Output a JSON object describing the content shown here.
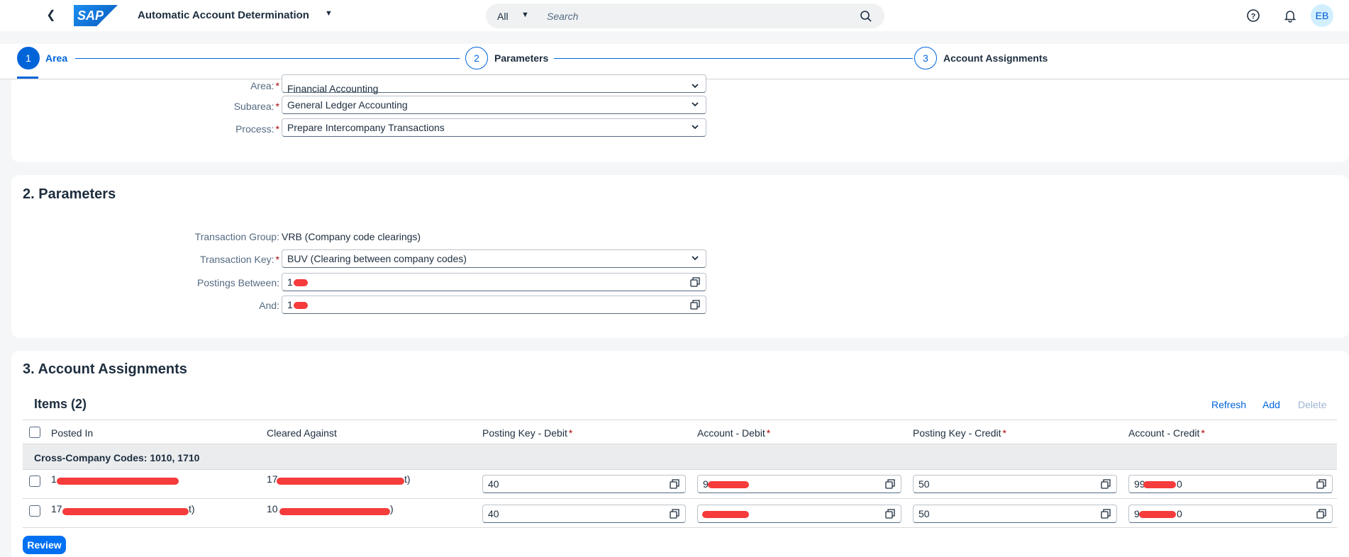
{
  "shell": {
    "logo": "SAP",
    "app_title": "Automatic Account Determination",
    "search_scope": "All",
    "search_placeholder": "Search",
    "avatar_initials": "EB"
  },
  "wizard": {
    "steps": [
      {
        "number": "1",
        "label": "Area",
        "active": true
      },
      {
        "number": "2",
        "label": "Parameters",
        "active": false
      },
      {
        "number": "3",
        "label": "Account Assignments",
        "active": false
      }
    ]
  },
  "area": {
    "fields": [
      {
        "label": "Area:",
        "value": "Financial Accounting"
      },
      {
        "label": "Subarea:",
        "value": "General Ledger Accounting"
      },
      {
        "label": "Process:",
        "value": "Prepare Intercompany Transactions"
      }
    ]
  },
  "parameters": {
    "title": "2. Parameters",
    "transaction_group_label": "Transaction Group:",
    "transaction_group_value": "VRB (Company code clearings)",
    "transaction_key_label": "Transaction Key:",
    "transaction_key_value": "BUV (Clearing between company codes)",
    "postings_between_label": "Postings Between:",
    "postings_between_value": "1",
    "and_label": "And:",
    "and_value": "1"
  },
  "assignments": {
    "title": "3. Account Assignments",
    "items_title": "Items (2)",
    "toolbar": {
      "refresh": "Refresh",
      "add": "Add",
      "delete": "Delete"
    },
    "columns": [
      "Posted In",
      "Cleared Against",
      "Posting Key - Debit",
      "Account - Debit",
      "Posting Key - Credit",
      "Account - Credit"
    ],
    "required_marker": "*",
    "group_label": "Cross-Company Codes: 1010, 1710",
    "rows": [
      {
        "posted_in": "1",
        "cleared_against": "17",
        "cleared_suffix": "t)",
        "pk_debit": "40",
        "acct_debit": "9",
        "pk_credit": "50",
        "acct_credit": "99",
        "acct_credit_suffix": "0"
      },
      {
        "posted_in": "17",
        "posted_suffix": "t)",
        "cleared_against": "10",
        "cleared_suffix": ")",
        "pk_debit": "40",
        "acct_debit": "",
        "pk_credit": "50",
        "acct_credit": "9",
        "acct_credit_suffix": "0"
      }
    ],
    "review_button": "Review"
  }
}
